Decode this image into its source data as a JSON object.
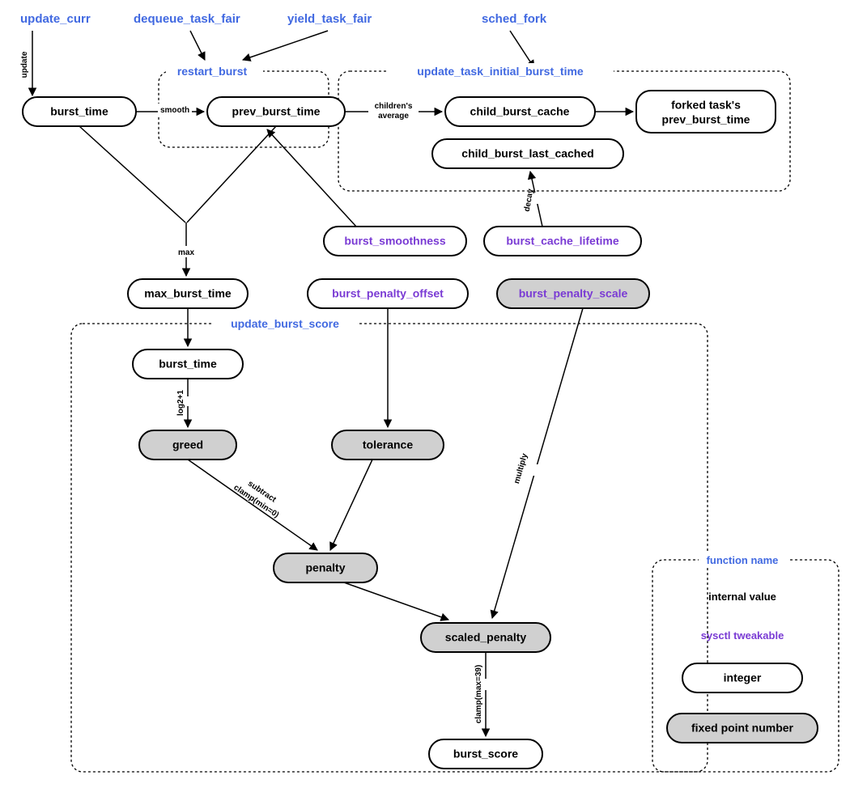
{
  "entries": {
    "update_curr": "update_curr",
    "dequeue_task_fair": "dequeue_task_fair",
    "yield_task_fair": "yield_task_fair",
    "sched_fork": "sched_fork"
  },
  "groups": {
    "restart_burst": "restart_burst",
    "update_task_initial": "update_task_initial_burst_time",
    "update_burst_score": "update_burst_score"
  },
  "nodes": {
    "burst_time": "burst_time",
    "prev_burst_time": "prev_burst_time",
    "child_burst_cache": "child_burst_cache",
    "forked_task_line1": "forked task's",
    "forked_task_line2": "prev_burst_time",
    "child_burst_last_cached": "child_burst_last_cached",
    "burst_smoothness": "burst_smoothness",
    "burst_cache_lifetime": "burst_cache_lifetime",
    "max_burst_time": "max_burst_time",
    "burst_penalty_offset": "burst_penalty_offset",
    "burst_penalty_scale": "burst_penalty_scale",
    "burst_time2": "burst_time",
    "greed": "greed",
    "tolerance": "tolerance",
    "penalty": "penalty",
    "scaled_penalty": "scaled_penalty",
    "burst_score": "burst_score"
  },
  "edge_labels": {
    "update": "update",
    "smooth": "smooth",
    "childrens_avg_line1": "children's",
    "childrens_avg_line2": "average",
    "decay": "decay",
    "max": "max",
    "log2p1": "log2+1",
    "subtract": "subtract",
    "clamp_min0": "clamp(min=0)",
    "multiply": "multiply",
    "clamp_max39": "clamp(max=39)"
  },
  "legend": {
    "function_name": "function name",
    "internal_value": "internal value",
    "sysctl_tweakable": "sysctl tweakable",
    "integer": "integer",
    "fixed_point": "fixed point number"
  }
}
